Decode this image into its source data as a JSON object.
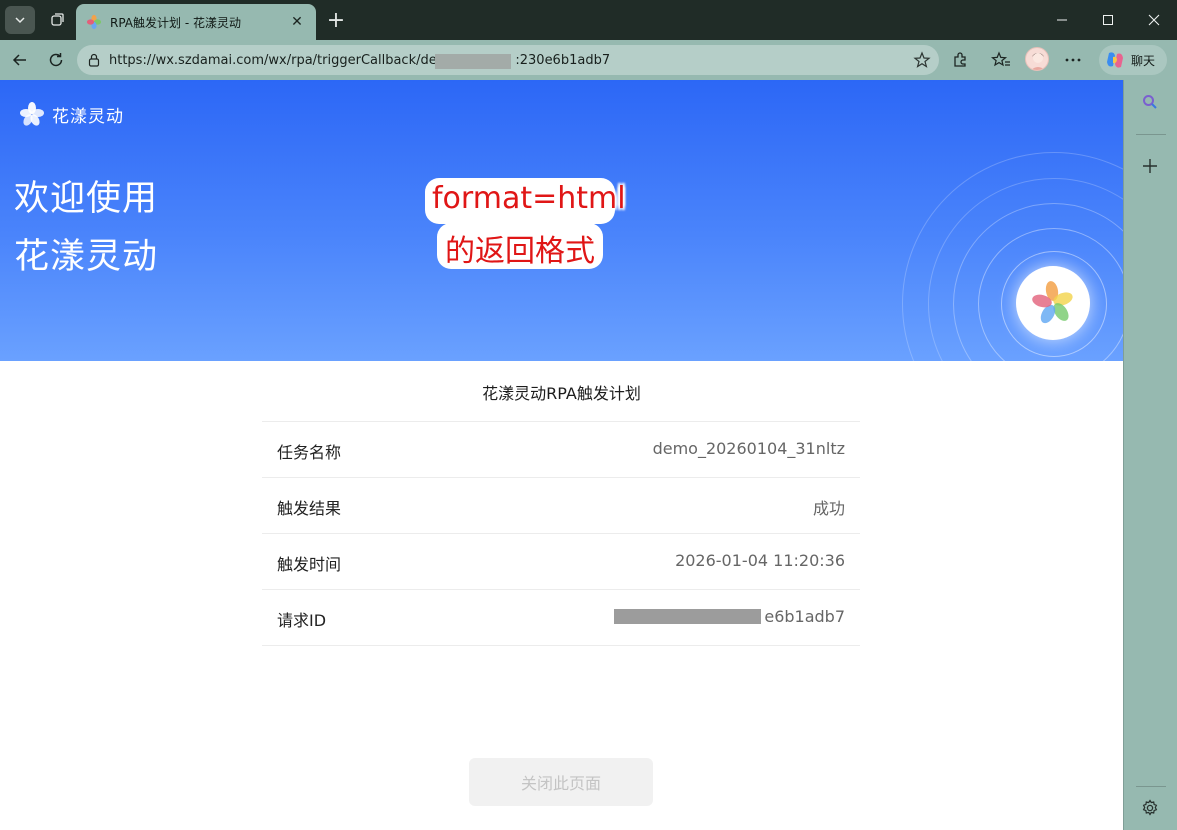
{
  "browser": {
    "tab_title": "RPA触发计划 - 花漾灵动",
    "tab_close": "✕",
    "new_tab": "+",
    "url": "https://wx.szdamai.com/wx/rpa/triggerCallback/dea216effd8d                 :230e6b1adb7",
    "copilot_label": "聊天"
  },
  "page": {
    "brand": "花漾灵动",
    "hero_line1": "欢迎使用",
    "hero_line2": "花漾灵动",
    "annotation_line1": "format=html",
    "annotation_line2": "的返回格式",
    "card_title": "花漾灵动RPA触发计划",
    "rows": [
      {
        "label": "任务名称",
        "value": "demo_20260104_31nltz"
      },
      {
        "label": "触发结果",
        "value": "成功"
      },
      {
        "label": "触发时间",
        "value": "2026-01-04 11:20:36"
      },
      {
        "label": "请求ID",
        "value": "dea216eff                          e6b1adb7"
      }
    ],
    "close_button": "关闭此页面"
  },
  "colors": {
    "hero_top": "#2c67f6",
    "hero_bottom": "#6aa1ff",
    "annotation": "#e01616",
    "chrome_bg": "#96b9b0",
    "titlebar_bg": "#202c27"
  },
  "icons": [
    "tab-actions-icon",
    "workspaces-icon",
    "favicon-icon",
    "back-icon",
    "refresh-icon",
    "lock-icon",
    "star-icon",
    "extensions-icon",
    "favorites-icon",
    "more-icon",
    "copilot-icon",
    "search-icon",
    "add-icon",
    "settings-icon",
    "flower-logo-icon"
  ]
}
